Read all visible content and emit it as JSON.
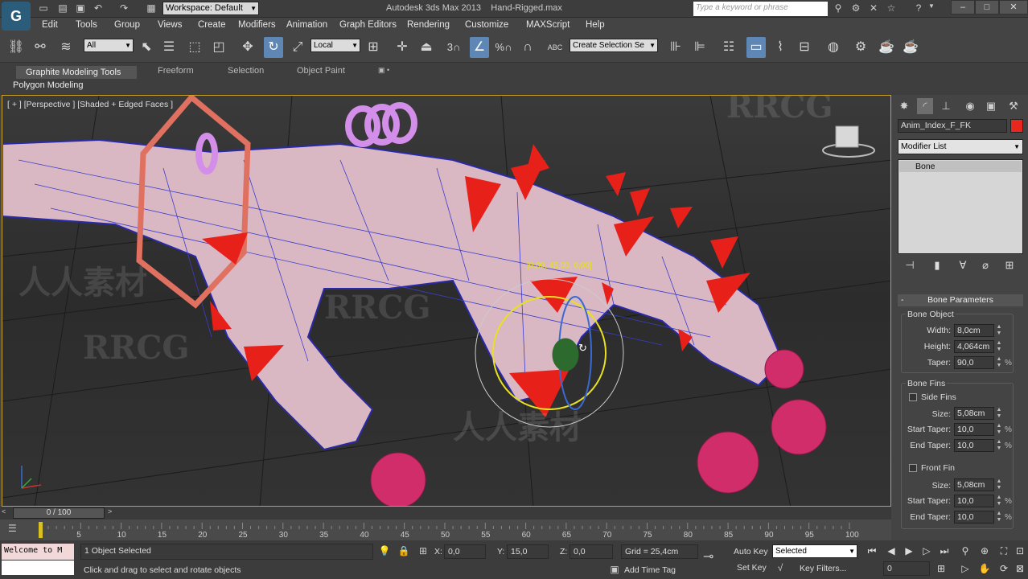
{
  "title_bar": {
    "logo": "G",
    "workspace": "Workspace: Default",
    "app_title": "Autodesk 3ds Max  2013",
    "file_name": "Hand-Rigged.max",
    "search_placeholder": "Type a keyword or phrase"
  },
  "menu": [
    "Edit",
    "Tools",
    "Group",
    "Views",
    "Create",
    "Modifiers",
    "Animation",
    "Graph Editors",
    "Rendering",
    "Customize",
    "MAXScript",
    "Help"
  ],
  "toolbar": {
    "filter": "All",
    "coord_system": "Local",
    "snap_num": "3",
    "angle_snap_label": "%",
    "named_selection": "Create Selection Se",
    "abc_label": "ABC"
  },
  "ribbon": {
    "tabs": [
      "Graphite Modeling Tools",
      "Freeform",
      "Selection",
      "Object Paint"
    ],
    "panel": "Polygon Modeling"
  },
  "viewport": {
    "label": "[ + ] [Perspective ] [Shaded + Edged Faces ]",
    "gizmo_readout": "[0,00, 45,00, 0,00]",
    "view_cube": "top"
  },
  "command_panel": {
    "object_name": "Anim_Index_F_FK",
    "object_color": "#e8281e",
    "modifier_list": "Modifier List",
    "stack": [
      "Bone"
    ],
    "rollout_title": "Bone Parameters",
    "bone_object": {
      "group": "Bone Object",
      "width_label": "Width:",
      "width": "8,0cm",
      "height_label": "Height:",
      "height": "4,064cm",
      "taper_label": "Taper:",
      "taper": "90,0"
    },
    "bone_fins": {
      "group": "Bone Fins",
      "side_fins": "Side Fins",
      "side_size_label": "Size:",
      "side_size": "5,08cm",
      "side_start_label": "Start Taper:",
      "side_start": "10,0",
      "side_end_label": "End Taper:",
      "side_end": "10,0",
      "front_fin": "Front Fin",
      "front_size_label": "Size:",
      "front_size": "5,08cm",
      "front_start_label": "Start Taper:",
      "front_start": "10,0",
      "front_end_label": "End Taper:",
      "front_end": "10,0"
    },
    "percent": "%"
  },
  "timeline": {
    "slider": "0 / 100",
    "ticks": [
      "5",
      "10",
      "15",
      "20",
      "25",
      "30",
      "35",
      "40",
      "45",
      "50",
      "55",
      "60",
      "65",
      "70",
      "75",
      "80",
      "85",
      "90",
      "95",
      "100"
    ]
  },
  "status": {
    "maxscript_line1": "Welcome to M",
    "objects_selected": "1 Object Selected",
    "prompt": "Click and drag to select and rotate objects",
    "x_label": "X:",
    "x_val": "0,0",
    "y_label": "Y:",
    "y_val": "15,0",
    "z_label": "Z:",
    "z_val": "0,0",
    "grid": "Grid = 25,4cm",
    "add_time_tag": "Add Time Tag",
    "auto_key": "Auto Key",
    "set_key": "Set Key",
    "key_mode": "Selected",
    "key_filters": "Key Filters...",
    "frame": "0"
  },
  "watermarks": [
    "RRCG",
    "人人素材"
  ]
}
